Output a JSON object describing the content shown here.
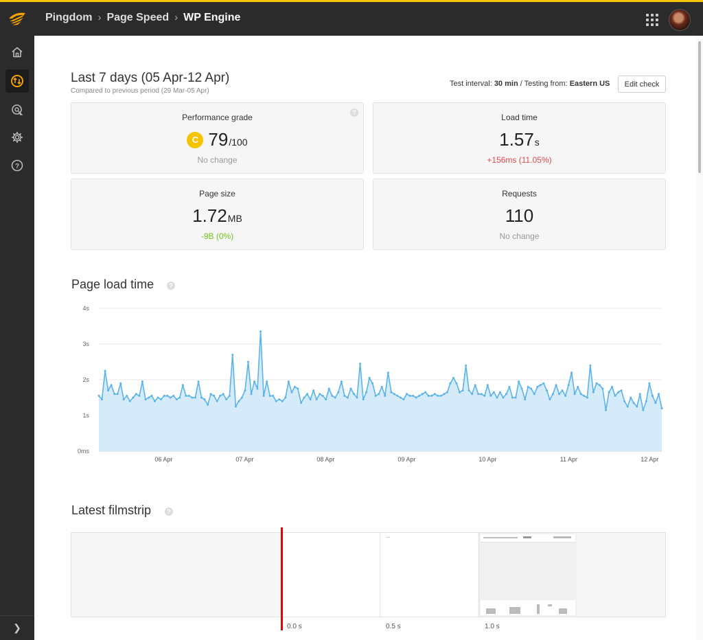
{
  "header": {
    "breadcrumb": [
      "Pingdom",
      "Page Speed",
      "WP Engine"
    ]
  },
  "sidebar": {
    "items": [
      {
        "name": "home-icon"
      },
      {
        "name": "page-speed-icon",
        "active": true
      },
      {
        "name": "transaction-icon"
      },
      {
        "name": "settings-icon"
      },
      {
        "name": "help-icon"
      }
    ],
    "expand_icon": "chevron-right-icon"
  },
  "summary": {
    "period_title": "Last 7 days (05 Apr-12 Apr)",
    "period_subtitle": "Compared to previous period (29 Mar-05 Apr)",
    "test_interval_label": "Test interval:",
    "test_interval_value": "30 min",
    "testing_from_label": "/ Testing from:",
    "testing_from_value": "Eastern US",
    "edit_button": "Edit check"
  },
  "cards": {
    "grade": {
      "label": "Performance grade",
      "letter": "C",
      "value": "79",
      "unit": "/100",
      "change": "No change"
    },
    "load_time": {
      "label": "Load time",
      "value": "1.57",
      "unit": "s",
      "change": "+156ms (11.05%)"
    },
    "page_size": {
      "label": "Page size",
      "value": "1.72",
      "unit": "MB",
      "change": "-9B (0%)"
    },
    "requests": {
      "label": "Requests",
      "value": "110",
      "change": "No change"
    }
  },
  "colors": {
    "accent": "#f5c400",
    "grade_c": "#f5c400",
    "negative": "#e5484d",
    "positive": "#72c41e",
    "series_line": "#5ab4ea",
    "series_fill": "#d6ebfa"
  },
  "sections": {
    "load_time_title": "Page load time",
    "filmstrip_title": "Latest filmstrip"
  },
  "chart_data": {
    "type": "area",
    "title": "Page load time",
    "ylim": [
      0,
      4
    ],
    "yticks": [
      "0ms",
      "1s",
      "2s",
      "3s",
      "4s"
    ],
    "xticks": [
      "06 Apr",
      "07 Apr",
      "08 Apr",
      "09 Apr",
      "10 Apr",
      "11 Apr",
      "12 Apr"
    ],
    "x_start_day": 5.2,
    "x_end_day": 12.15,
    "grid": true,
    "series": [
      {
        "values": [
          1.55,
          1.45,
          2.25,
          1.7,
          1.85,
          1.6,
          1.6,
          1.9,
          1.45,
          1.55,
          1.4,
          1.5,
          1.6,
          1.55,
          1.95,
          1.45,
          1.5,
          1.55,
          1.4,
          1.5,
          1.45,
          1.55,
          1.55,
          1.5,
          1.55,
          1.45,
          1.5,
          1.85,
          1.55,
          1.55,
          1.5,
          1.5,
          1.95,
          1.5,
          1.45,
          1.3,
          1.6,
          1.55,
          1.4,
          1.55,
          1.6,
          1.45,
          1.55,
          2.7,
          1.25,
          1.4,
          1.5,
          1.7,
          2.5,
          1.6,
          1.95,
          1.75,
          3.35,
          1.55,
          1.95,
          1.55,
          1.55,
          1.4,
          1.45,
          1.4,
          1.5,
          1.95,
          1.65,
          1.8,
          1.75,
          1.35,
          1.5,
          1.6,
          1.45,
          1.7,
          1.45,
          1.6,
          1.55,
          1.45,
          1.75,
          1.55,
          1.5,
          1.65,
          1.95,
          1.55,
          1.5,
          1.75,
          1.6,
          1.5,
          2.45,
          1.45,
          1.65,
          2.05,
          1.9,
          1.55,
          1.6,
          1.8,
          1.55,
          2.2,
          1.65,
          1.6,
          1.55,
          1.5,
          1.45,
          1.6,
          1.55,
          1.55,
          1.5,
          1.55,
          1.6,
          1.65,
          1.55,
          1.55,
          1.6,
          1.55,
          1.55,
          1.6,
          1.65,
          1.9,
          2.05,
          1.9,
          1.65,
          1.7,
          2.4,
          1.7,
          1.6,
          1.85,
          1.6,
          1.6,
          1.55,
          1.85,
          1.55,
          1.65,
          1.5,
          1.65,
          1.5,
          1.6,
          1.8,
          1.5,
          1.5,
          1.95,
          1.75,
          1.45,
          1.8,
          1.75,
          1.6,
          1.8,
          1.85,
          1.9,
          1.7,
          1.45,
          1.6,
          1.85,
          1.6,
          1.7,
          1.55,
          1.85,
          2.2,
          1.6,
          1.8,
          1.6,
          1.55,
          1.5,
          2.4,
          1.65,
          1.9,
          1.85,
          1.75,
          1.15,
          1.65,
          1.8,
          1.55,
          1.65,
          1.7,
          1.4,
          1.25,
          1.5,
          1.35,
          1.25,
          1.6,
          1.15,
          1.4,
          1.9,
          1.55,
          1.35,
          1.6,
          1.2
        ]
      }
    ]
  },
  "filmstrip": {
    "time_labels": [
      "0.0 s",
      "0.5 s",
      "1.0 s"
    ],
    "frame_count": 3
  }
}
